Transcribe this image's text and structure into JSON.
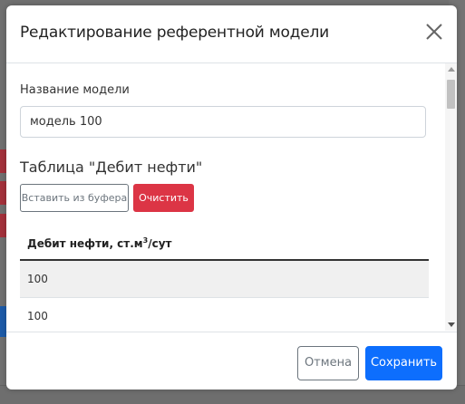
{
  "modal": {
    "title": "Редактирование референтной модели",
    "close_icon": "close-icon"
  },
  "form": {
    "name_label": "Название модели",
    "name_value": "модель 100"
  },
  "table_section": {
    "title": "Таблица \"Дебит нефти\"",
    "paste_button": "Вставить из буфера",
    "clear_button": "Очистить",
    "column_header": "Дебит нефти, ст.м",
    "column_header_sup": "3",
    "column_header_suffix": "/сут",
    "rows": [
      "100",
      "100"
    ]
  },
  "footer": {
    "cancel_label": "Отмена",
    "save_label": "Сохранить"
  },
  "colors": {
    "primary": "#0d6efd",
    "danger": "#dc3545",
    "secondary": "#6c757d"
  }
}
